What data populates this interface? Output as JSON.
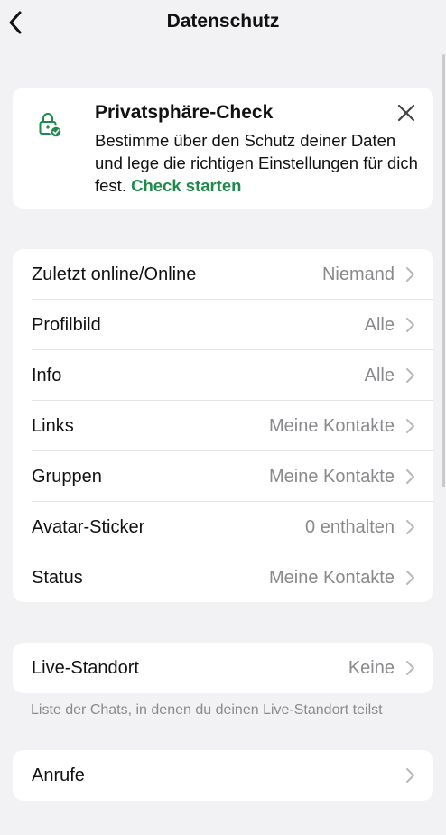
{
  "header": {
    "title": "Datenschutz"
  },
  "privacy_check": {
    "title": "Privatsphäre-Check",
    "body": "Bestimme über den Schutz deiner Daten und lege die richtigen Einstellungen für dich fest.",
    "link": "Check starten"
  },
  "settings": {
    "items": [
      {
        "label": "Zuletzt online/Online",
        "value": "Niemand"
      },
      {
        "label": "Profilbild",
        "value": "Alle"
      },
      {
        "label": "Info",
        "value": "Alle"
      },
      {
        "label": "Links",
        "value": "Meine Kontakte"
      },
      {
        "label": "Gruppen",
        "value": "Meine Kontakte"
      },
      {
        "label": "Avatar-Sticker",
        "value": "0 enthalten"
      },
      {
        "label": "Status",
        "value": "Meine Kontakte"
      }
    ]
  },
  "live_location": {
    "label": "Live-Standort",
    "value": "Keine",
    "footnote": "Liste der Chats, in denen du deinen Live-Standort teilst"
  },
  "calls": {
    "label": "Anrufe"
  },
  "colors": {
    "accent": "#1f8a4c",
    "background": "#f2f2f4",
    "secondary_text": "#8a8a8e"
  },
  "icons": [
    "back-arrow-icon",
    "lock-check-icon",
    "close-icon",
    "chevron-right-icon"
  ]
}
